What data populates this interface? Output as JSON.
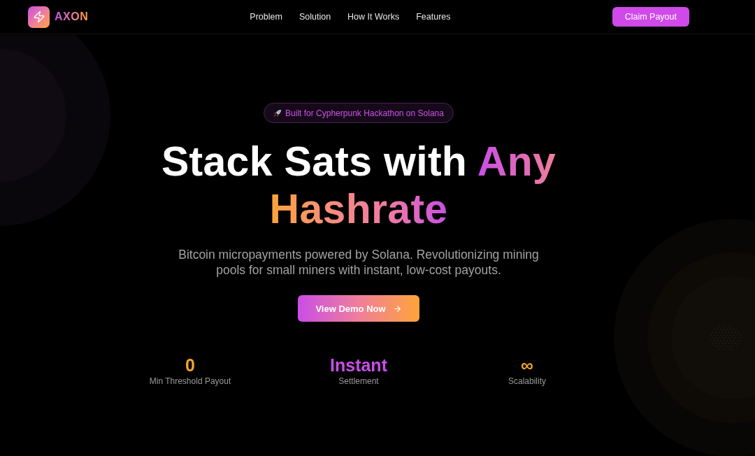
{
  "nav": {
    "brand": "AXON",
    "links": [
      "Problem",
      "Solution",
      "How It Works",
      "Features"
    ],
    "cta": "Claim Payout"
  },
  "hero": {
    "badge": "Built for Cypherpunk Hackathon on Solana",
    "heading": [
      {
        "text": "Stack Sats with",
        "kind": "plain"
      },
      {
        "text": "Any",
        "kind": "accent"
      },
      {
        "text": "Hashrate",
        "kind": "gradient"
      }
    ],
    "subtitle": "Bitcoin micropayments powered by Solana. Revolutionizing mining pools for small miners with instant, low-cost payouts.",
    "cta": "View Demo Now"
  },
  "stats": [
    {
      "value": "0",
      "label": "Min Threshold Payout",
      "color": "#f5a52a"
    },
    {
      "value": "Instant",
      "label": "Settlement",
      "color": "#c94ee6"
    },
    {
      "value": "∞",
      "label": "Scalability",
      "color": "#f5a52a"
    }
  ]
}
